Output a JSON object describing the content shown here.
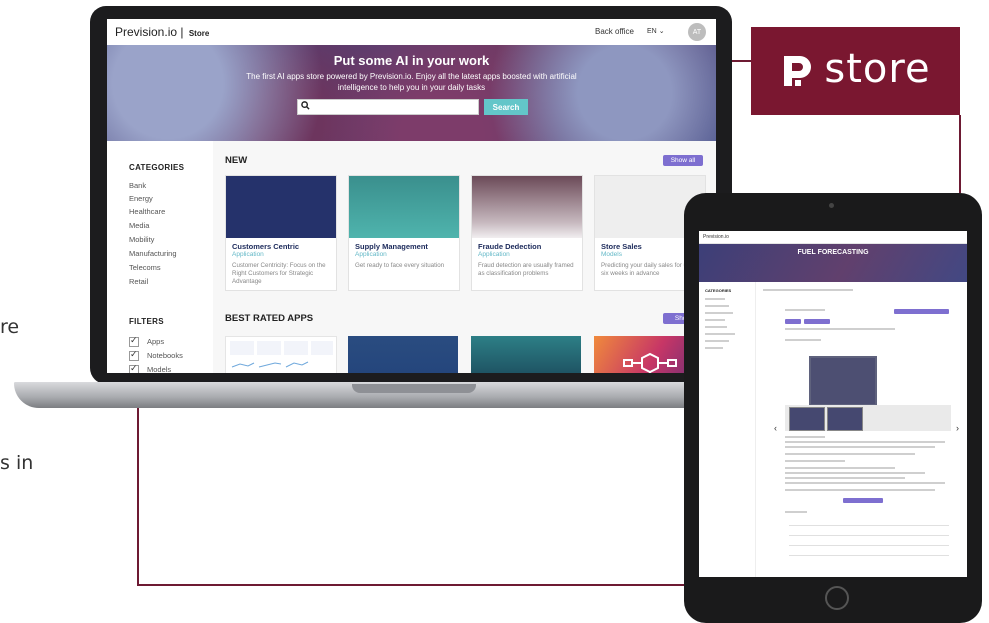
{
  "left_text": {
    "line1": "re",
    "line2": "s in"
  },
  "badge": {
    "text": "store",
    "bg": "#7a1730"
  },
  "laptop": {
    "brand": "Prevision.io",
    "brand_store": "Store",
    "back_office": "Back office",
    "lang": "EN",
    "avatar": "AT",
    "hero_title": "Put some AI in your work",
    "hero_subtitle": "The first AI apps store powered by Prevision.io. Enjoy all the latest apps boosted with artificial intelligence to help you in your daily tasks",
    "search_button": "Search",
    "categories_title": "CATEGORIES",
    "categories": [
      "Bank",
      "Energy",
      "Healthcare",
      "Media",
      "Mobility",
      "Manufacturing",
      "Telecoms",
      "Retail"
    ],
    "filters_title": "FILTERS",
    "filters": [
      "Apps",
      "Notebooks",
      "Models"
    ],
    "new_title": "NEW",
    "show_all": "Show all",
    "show_all_2": "Show",
    "best_title": "BEST RATED APPS",
    "cards": [
      {
        "title": "Customers Centric",
        "type": "Application",
        "desc": "Customer Centricity: Focus on the Right Customers for Strategic Advantage",
        "color": "#25326b"
      },
      {
        "title": "Supply Management",
        "type": "Application",
        "desc": "Get ready to face every situation",
        "color": "#3f9c97"
      },
      {
        "title": "Fraude Dedection",
        "type": "Application",
        "desc": "Fraud detection are usually framed as classification problems",
        "color": "#7a5c6b"
      },
      {
        "title": "Store Sales",
        "type": "Models",
        "desc": "Predicting your daily sales for up to six weeks in advance",
        "color": "#eeeeee"
      }
    ]
  },
  "tablet": {
    "brand": "Prevision.io",
    "hero_title": "FUEL FORECASTING",
    "side_title": "CATEGORIES"
  }
}
